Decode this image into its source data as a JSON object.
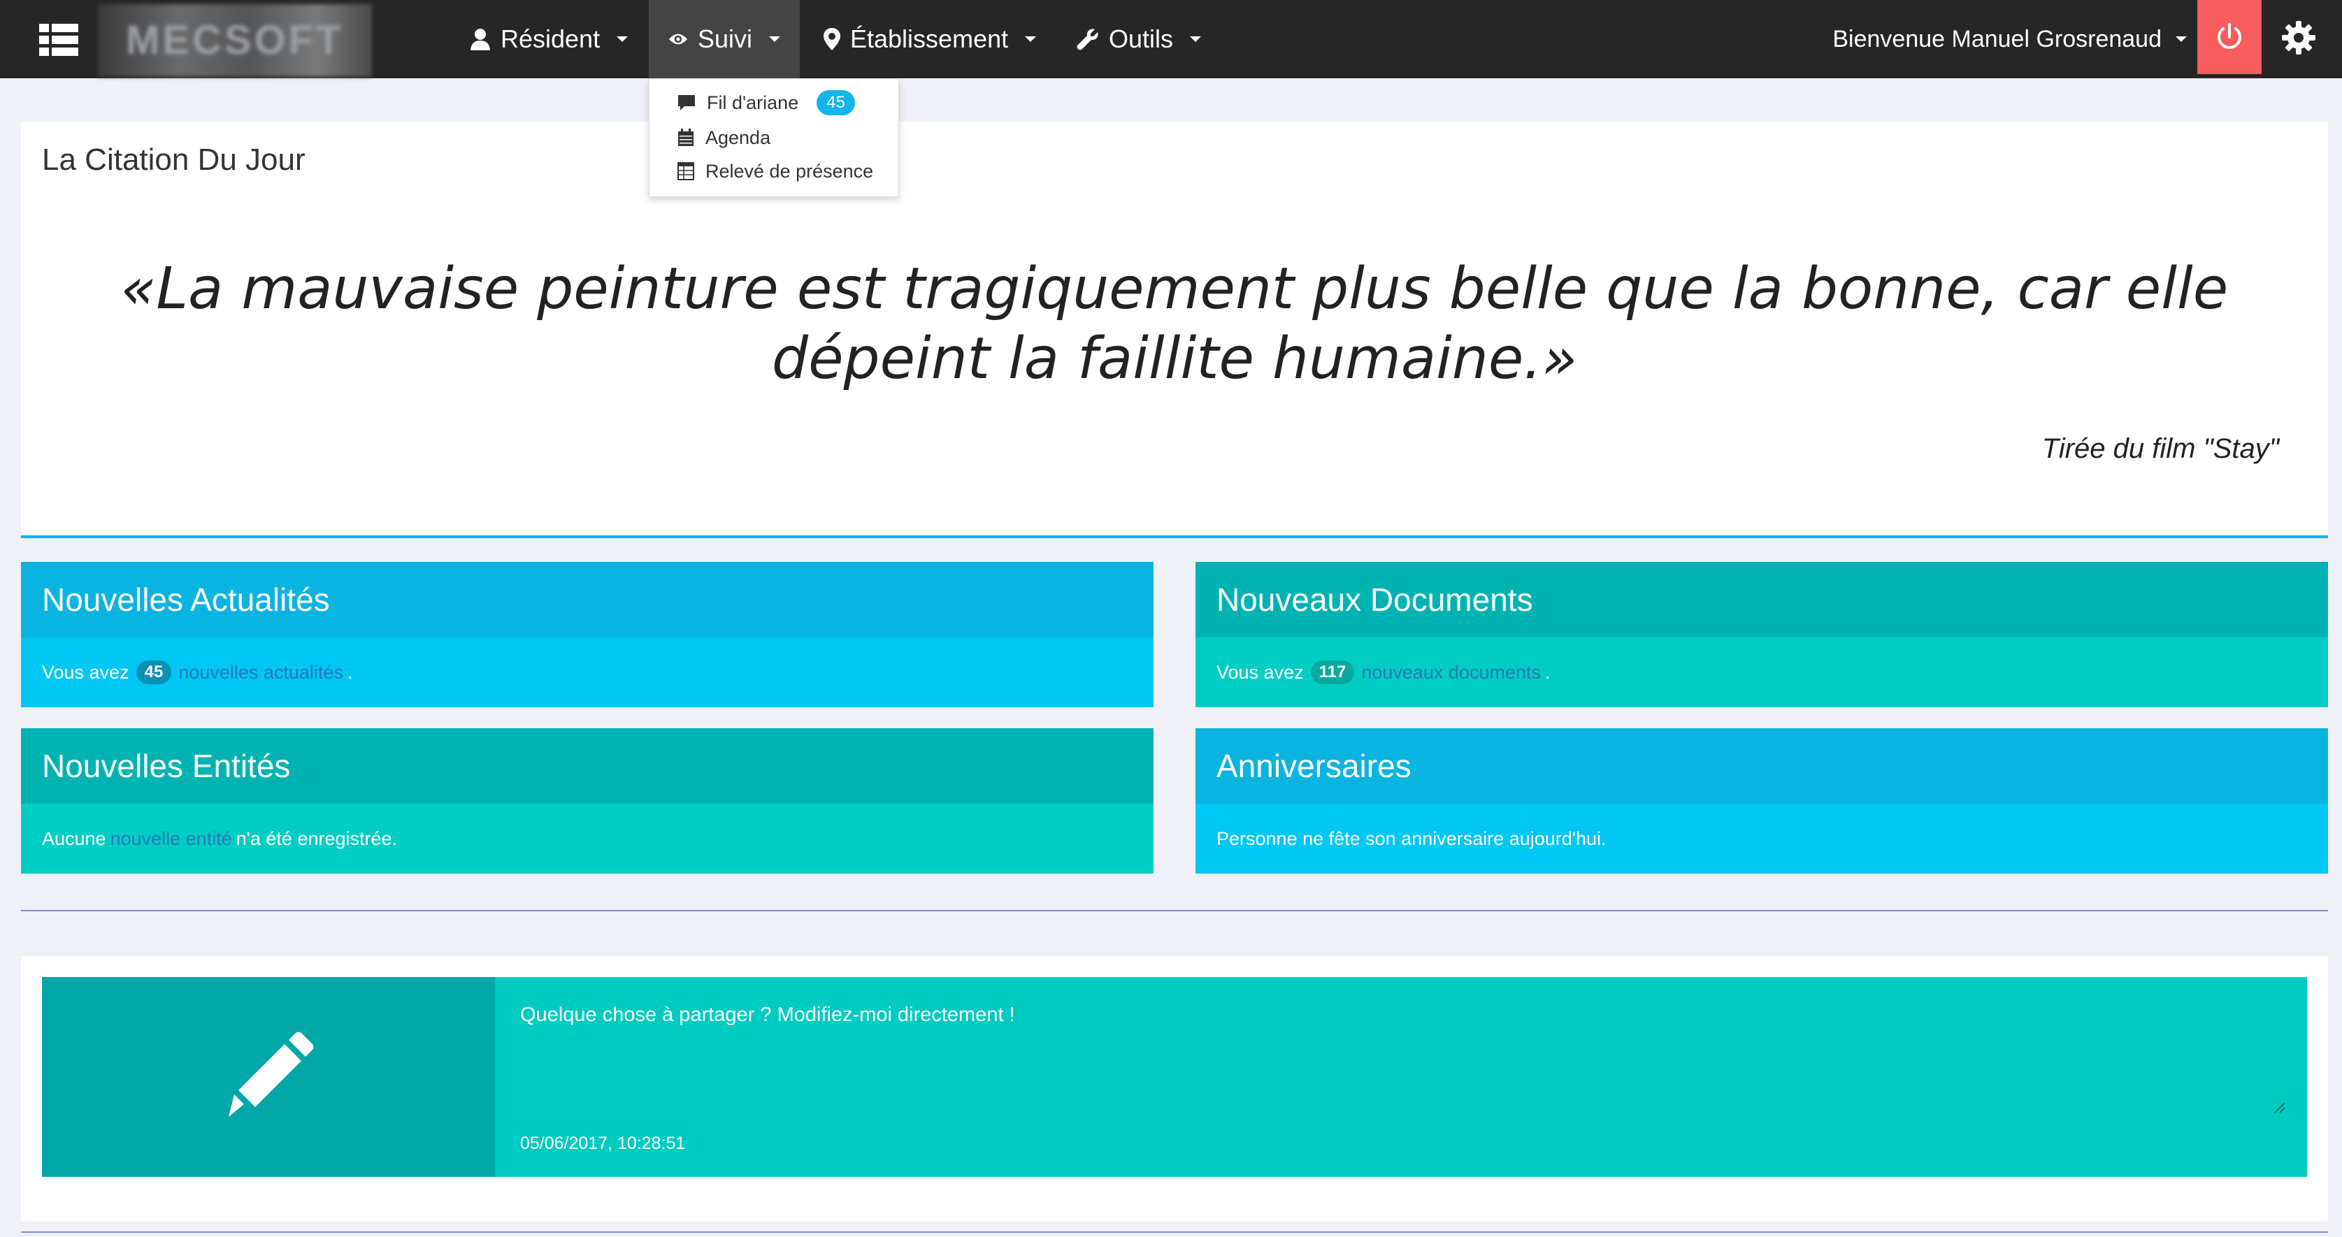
{
  "navbar": {
    "logo_text": "MECSOFT",
    "items": [
      {
        "label": "Résident",
        "icon": "user-icon"
      },
      {
        "label": "Suivi",
        "icon": "eye-icon"
      },
      {
        "label": "Établissement",
        "icon": "map-marker-icon"
      },
      {
        "label": "Outils",
        "icon": "wrench-icon"
      }
    ],
    "welcome": "Bienvenue Manuel Grosrenaud",
    "accent_power": "#f85c5c"
  },
  "dropdown": {
    "items": [
      {
        "label": "Fil d'ariane",
        "icon": "comment-icon",
        "badge": "45"
      },
      {
        "label": "Agenda",
        "icon": "calendar-icon"
      },
      {
        "label": "Relevé de présence",
        "icon": "table-icon"
      }
    ]
  },
  "quote": {
    "title": "La Citation Du Jour",
    "text": "«La mauvaise peinture est tragiquement plus belle que la bonne, car elle dépeint la faillite humaine.»",
    "source": "Tirée du film \"Stay\""
  },
  "boxes": {
    "news": {
      "title": "Nouvelles Actualités",
      "prefix": "Vous avez",
      "count": "45",
      "link": "nouvelles actualités",
      "suffix": "."
    },
    "docs": {
      "title": "Nouveaux Documents",
      "prefix": "Vous avez",
      "count": "117",
      "link": "nouveaux documents",
      "suffix": "."
    },
    "entities": {
      "title": "Nouvelles Entités",
      "prefix": "Aucune",
      "link": "nouvelle entité",
      "suffix": "n'a été enregistrée."
    },
    "birthdays": {
      "title": "Anniversaires",
      "text": "Personne ne fête son anniversaire aujourd'hui."
    }
  },
  "share": {
    "text": "Quelque chose à partager ? Modifiez-moi directement !",
    "date": "05/06/2017, 10:28:51",
    "icon": "pencil-icon"
  },
  "colors": {
    "navbar": "#262626",
    "blue_head": "#0ab4e0",
    "blue_body": "#00c7f4",
    "teal_head": "#00b3b3",
    "teal_body": "#00cec4",
    "badge": "#11b6ea"
  }
}
